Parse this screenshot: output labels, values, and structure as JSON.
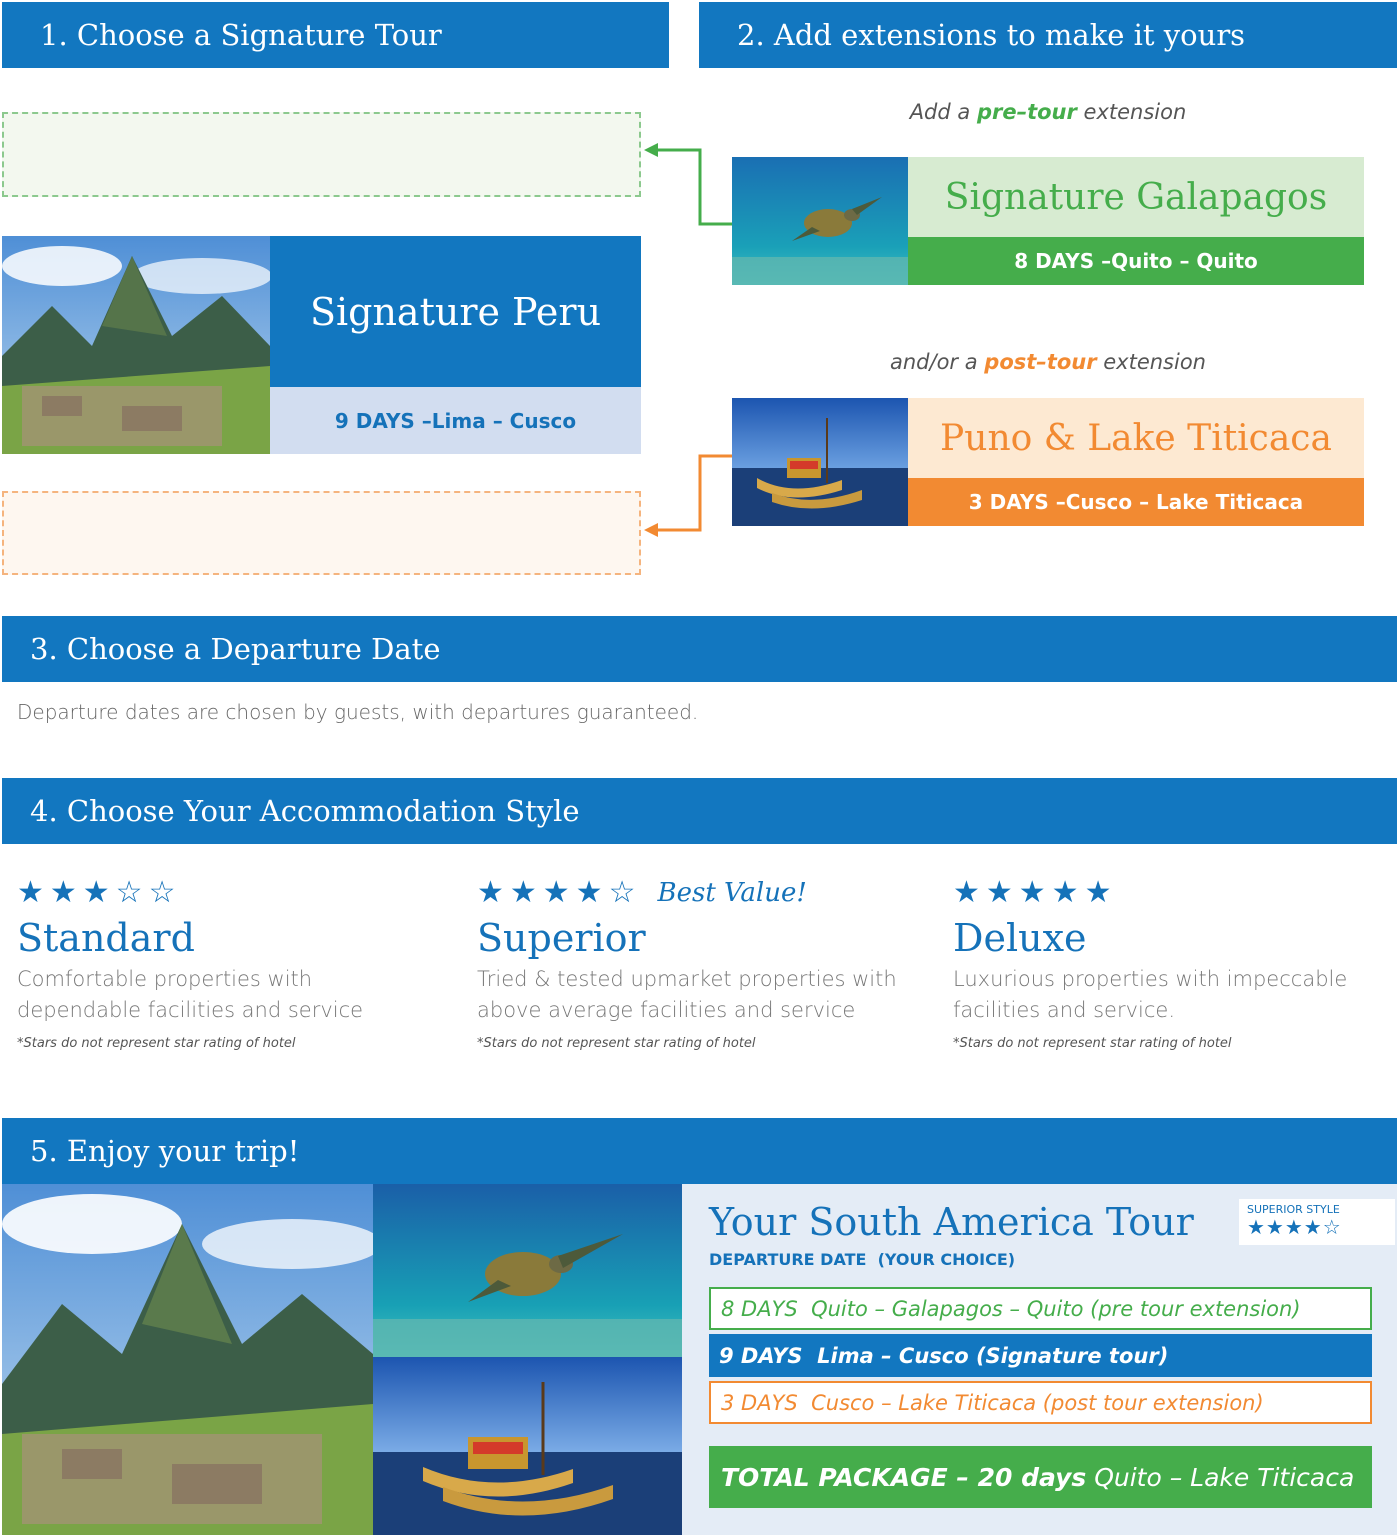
{
  "step1": {
    "title": "1. Choose a Signature Tour"
  },
  "step2": {
    "title": "2. Add extensions to make it yours"
  },
  "pre_note": {
    "prefix": "Add a",
    "highlight": "pre–tour",
    "suffix": "extension"
  },
  "post_note": {
    "prefix": "and/or a",
    "highlight": "post–tour",
    "suffix": "extension"
  },
  "main_tour": {
    "name": "Signature Peru",
    "days": "9 DAYS –Lima – Cusco"
  },
  "pre_tour": {
    "name": "Signature Galapagos",
    "days": "8 DAYS –Quito – Quito"
  },
  "post_tour": {
    "name": "Puno & Lake Titicaca",
    "days": "3 DAYS –Cusco – Lake Titicaca"
  },
  "step3": {
    "title": "3. Choose a Departure Date",
    "text": "Departure dates are chosen by guests, with departures guaranteed."
  },
  "step4": {
    "title": "4. Choose Your Accommodation Style"
  },
  "accommodations": [
    {
      "stars": "★★★☆☆",
      "name": "Standard",
      "description": "Comfortable properties with dependable facilities and service",
      "footnote": "*Stars do not represent star rating of hotel"
    },
    {
      "stars": "★★★★☆",
      "badge": "Best Value!",
      "name": "Superior",
      "description": "Tried & tested upmarket properties with above average facilities and service",
      "footnote": "*Stars do not represent star rating of hotel"
    },
    {
      "stars": "★★★★★",
      "name": "Deluxe",
      "description": "Luxurious properties with impeccable facilities and service.",
      "footnote": "*Stars do not represent star rating of hotel"
    }
  ],
  "step5": {
    "title": "5. Enjoy your trip!"
  },
  "summary": {
    "title": "Your South America Tour",
    "departure": "DEPARTURE DATE  (YOUR CHOICE)",
    "style_label": "SUPERIOR STYLE",
    "style_stars": "★★★★☆",
    "lines": [
      {
        "days": "8 DAYS",
        "text": "Quito – Galapagos – Quito (pre tour extension)"
      },
      {
        "days": "9 DAYS",
        "text": "Lima – Cusco  (Signature tour)"
      },
      {
        "days": "3 DAYS",
        "text": "Cusco – Lake Titicaca (post tour extension)"
      }
    ],
    "total_label": "TOTAL PACKAGE – 20 days",
    "total_route": "Quito – Lake Titicaca"
  },
  "colors": {
    "brand_blue": "#1277c0",
    "pre_green": "#45ad4b",
    "post_orange": "#f28a32",
    "pale_blue": "#d2ddf0"
  },
  "icons": [
    "mountain-photo",
    "turtle-photo",
    "reed-boat-photo",
    "arrow-left-icon",
    "star-icon"
  ]
}
